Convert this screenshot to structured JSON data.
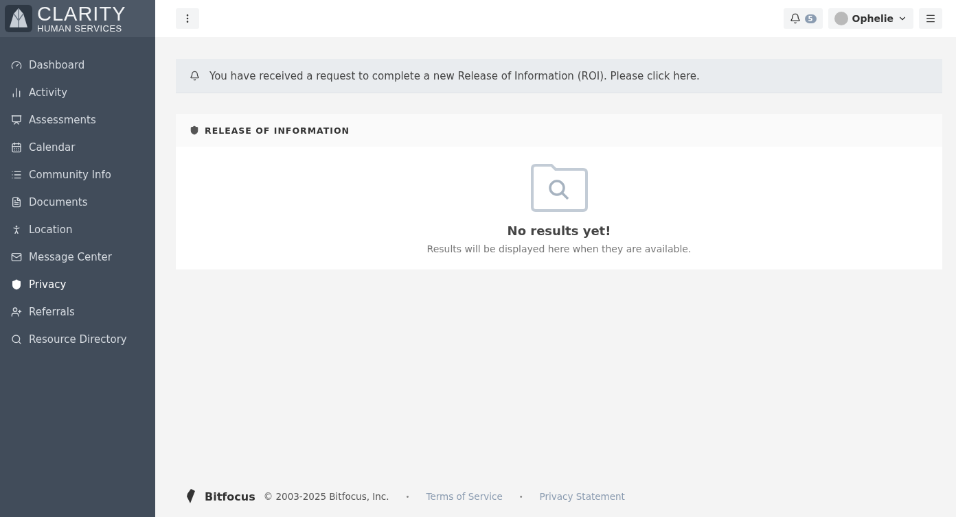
{
  "brand": {
    "title": "CLARITY",
    "subtitle": "HUMAN SERVICES"
  },
  "sidebar": {
    "items": [
      {
        "label": "Dashboard",
        "selected": false
      },
      {
        "label": "Activity",
        "selected": false
      },
      {
        "label": "Assessments",
        "selected": false
      },
      {
        "label": "Calendar",
        "selected": false
      },
      {
        "label": "Community Info",
        "selected": false
      },
      {
        "label": "Documents",
        "selected": false
      },
      {
        "label": "Location",
        "selected": false
      },
      {
        "label": "Message Center",
        "selected": false
      },
      {
        "label": "Privacy",
        "selected": true
      },
      {
        "label": "Referrals",
        "selected": false
      },
      {
        "label": "Resource Directory",
        "selected": false
      }
    ]
  },
  "topbar": {
    "notifications_count": "5",
    "user": "Ophelie"
  },
  "alert": {
    "text": "You have received a request to complete a new Release of Information (ROI). Please click here."
  },
  "panel": {
    "title": "RELEASE OF INFORMATION",
    "empty_title": "No results yet!",
    "empty_text": "Results will be displayed here when they are available."
  },
  "footer": {
    "brand": "Bitfocus",
    "items": [
      {
        "kind": "text",
        "text": "© 2003-2025 Bitfocus, Inc."
      },
      {
        "kind": "separator",
        "text": "•"
      },
      {
        "kind": "link",
        "text": "Terms of Service"
      },
      {
        "kind": "separator",
        "text": "•"
      },
      {
        "kind": "link",
        "text": "Privacy Statement"
      }
    ]
  }
}
